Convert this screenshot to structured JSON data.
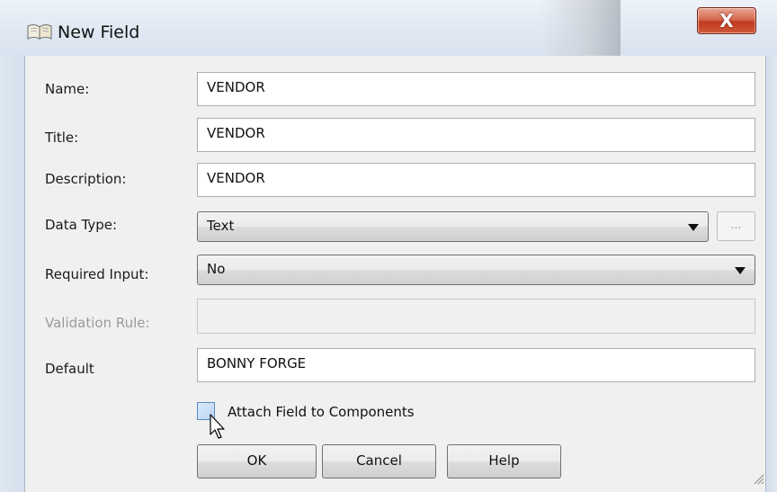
{
  "window": {
    "title": "New Field",
    "title_icon": "book-icon",
    "close_label": "X"
  },
  "form": {
    "name": {
      "label": "Name:",
      "value": "VENDOR"
    },
    "title": {
      "label": "Title:",
      "value": "VENDOR"
    },
    "description": {
      "label": "Description:",
      "value": "VENDOR"
    },
    "data_type": {
      "label": "Data Type:",
      "value": "Text",
      "ellipsis": "..."
    },
    "required_input": {
      "label": "Required Input:",
      "value": "No"
    },
    "validation_rule": {
      "label": "Validation Rule:",
      "value": ""
    },
    "default": {
      "label": "Default",
      "value": "BONNY FORGE"
    },
    "attach": {
      "label": "Attach Field to Components",
      "checked": false
    }
  },
  "buttons": {
    "ok": "OK",
    "cancel": "Cancel",
    "help": "Help"
  },
  "colors": {
    "close_button": "#c0391f",
    "dialog_background": "#f0f0f0",
    "checkbox_accent": "#5a8ac6"
  }
}
